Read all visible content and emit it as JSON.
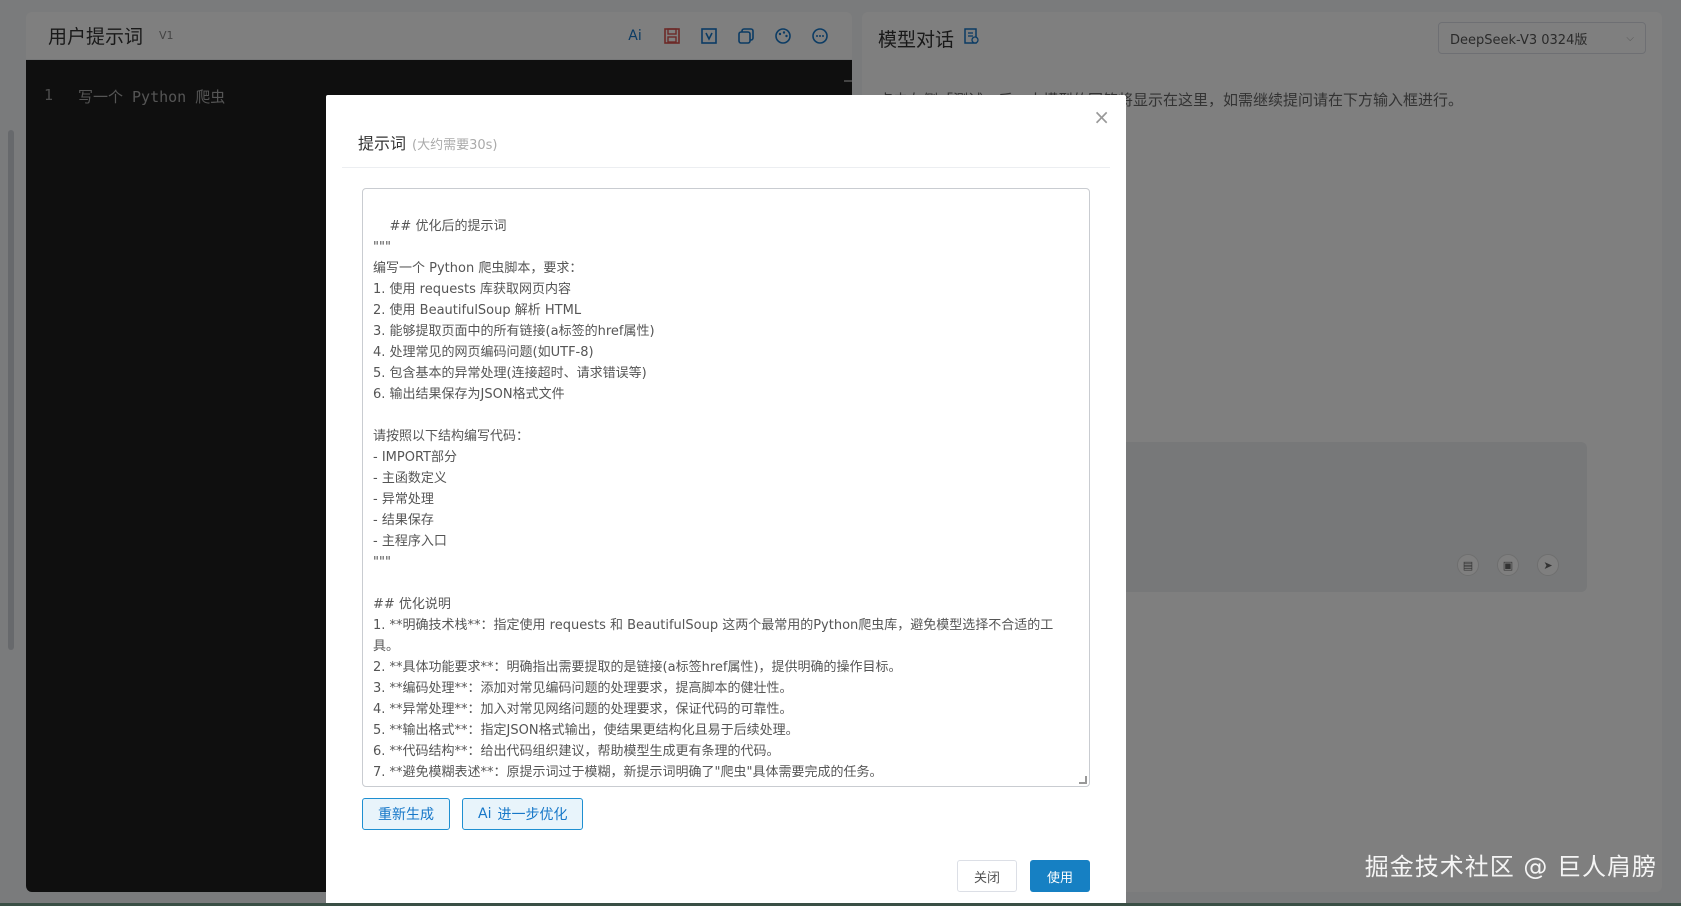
{
  "left": {
    "title": "用户提示词",
    "version": "V1",
    "code_line_no": "1",
    "code_text": "写一个 Python 爬虫"
  },
  "right": {
    "title": "模型对话",
    "model_select": "DeepSeek-V3 0324版",
    "hint": "点击左侧「测试」后，大模型的回答将显示在这里，如需继续提问请在下方输入框进行。"
  },
  "modal": {
    "title": "提示词",
    "subtitle": "(大约需要30s)",
    "content": "## 优化后的提示词\n\"\"\"\n编写一个 Python 爬虫脚本，要求：\n1. 使用 requests 库获取网页内容\n2. 使用 BeautifulSoup 解析 HTML\n3. 能够提取页面中的所有链接(a标签的href属性)\n4. 处理常见的网页编码问题(如UTF-8)\n5. 包含基本的异常处理(连接超时、请求错误等)\n6. 输出结果保存为JSON格式文件\n\n请按照以下结构编写代码：\n- IMPORT部分\n- 主函数定义\n- 异常处理\n- 结果保存\n- 主程序入口\n\"\"\"\n\n## 优化说明\n1. **明确技术栈**：指定使用 requests 和 BeautifulSoup 这两个最常用的Python爬虫库，避免模型选择不合适的工具。\n2. **具体功能要求**：明确指出需要提取的是链接(a标签href属性)，提供明确的操作目标。\n3. **编码处理**：添加对常见编码问题的处理要求，提高脚本的健壮性。\n4. **异常处理**：加入对常见网络问题的处理要求，保证代码的可靠性。\n5. **输出格式**：指定JSON格式输出，使结果更结构化且易于后续处理。\n6. **代码结构**：给出代码组织建议，帮助模型生成更有条理的代码。\n7. **避免模糊表述**：原提示词过于模糊，新提示词明确了\"爬虫\"具体需要完成的任务。",
    "regenerate_label": "重新生成",
    "optimize_label": "进一步优化",
    "close_label": "关闭",
    "use_label": "使用"
  },
  "watermark": "掘金技术社区 @ 巨人肩膀",
  "colors": {
    "accent": "#1680c3",
    "overlay": "rgba(0,0,0,0.5)"
  }
}
